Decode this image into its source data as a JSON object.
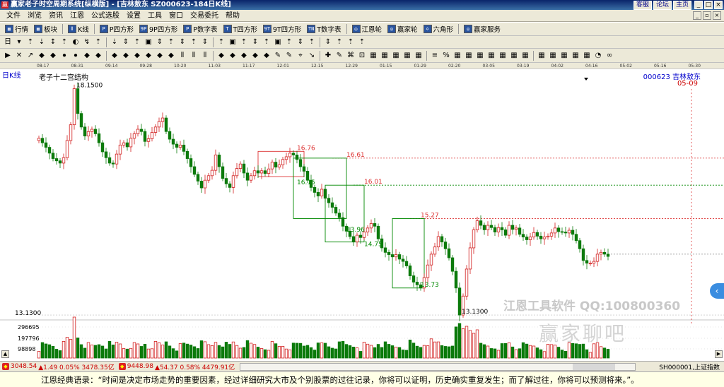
{
  "window": {
    "title": "赢家老子时空周期系统[纵横版] - [吉林敖东  SZ000623-184日K线]",
    "app_icon": "赢",
    "title_links": [
      "客服",
      "论坛",
      "主页"
    ],
    "buttons": [
      "_",
      "□",
      "×"
    ]
  },
  "menu": {
    "items": [
      "文件",
      "浏览",
      "资讯",
      "江恩",
      "公式选股",
      "设置",
      "工具",
      "窗口",
      "交易委托",
      "帮助"
    ],
    "window_controls": [
      "_",
      "▫",
      "×"
    ]
  },
  "toolbar1": {
    "items": [
      {
        "icon": "▦",
        "label": "行情"
      },
      {
        "icon": "▦",
        "label": "板块"
      },
      {
        "icon": "⫴",
        "label": "K线"
      },
      {
        "icon": "P",
        "label": "P四方形"
      },
      {
        "icon": "9P",
        "label": "9P四方形"
      },
      {
        "icon": "P",
        "label": "P数字表"
      },
      {
        "icon": "T",
        "label": "T四方形"
      },
      {
        "icon": "9T",
        "label": "9T四方形"
      },
      {
        "icon": "TN",
        "label": "T数字表"
      },
      {
        "icon": "◎",
        "label": "江恩轮"
      },
      {
        "icon": "◎",
        "label": "赢家轮"
      },
      {
        "icon": "✡",
        "label": "六角形"
      },
      {
        "icon": "◎",
        "label": "赢家服务"
      }
    ]
  },
  "toolbar2_icons": [
    "日",
    "▾",
    "⇡",
    "⇣",
    "↕",
    "⇡",
    "◐",
    "↯",
    "⇡",
    "⇣",
    "⇕",
    "⇡",
    "▣",
    "⇕",
    "⇡",
    "⇕",
    "⇡",
    "⇕",
    "⇡",
    "▣",
    "⇡",
    "⇕",
    "⇡",
    "▣",
    "⇡",
    "⇕",
    "⇡",
    "⇕",
    "⇡",
    "⇡",
    "⇡"
  ],
  "toolbar3_icons": [
    "▶",
    "✕",
    "↗",
    "◆",
    "◆",
    "⦁",
    "⦁",
    "◆",
    "◆",
    "◆",
    "◆",
    "◆",
    "◆",
    "◆",
    "◆",
    "⫴",
    "⫴",
    "⫴",
    "◆",
    "◆",
    "◆",
    "◆",
    "◆",
    "✎",
    "✎",
    "⌖",
    "↘",
    "✚",
    "✎",
    "⌘",
    "⊡",
    "▦",
    "▦",
    "▦",
    "▦",
    "▦",
    "≡",
    "%",
    "▦",
    "▦",
    "▦",
    "▦",
    "▦",
    "▦",
    "▦",
    "▦",
    "▦",
    "▦",
    "▦",
    "▦",
    "◔",
    "∞"
  ],
  "date_ticks": [
    "08-17",
    "08-31",
    "09-14",
    "09-28",
    "10-20",
    "11-03",
    "11-17",
    "12-01",
    "12-15",
    "12-29",
    "01-15",
    "01-29",
    "02-20",
    "03-05",
    "03-19",
    "04-02",
    "04-16",
    "05-02",
    "05-16",
    "05-30"
  ],
  "chart": {
    "period_label": "日K线",
    "structure_label": "老子十二宫结构",
    "stock_label": "000623 吉林敖东",
    "target_date": "05-09",
    "low_axis_label": "13.1300",
    "volume_labels": [
      "296695",
      "197796",
      "98898"
    ]
  },
  "chart_data": {
    "type": "candlestick",
    "stock": "000623 吉林敖东",
    "period": "日K线",
    "high_label": "18.1500",
    "low_label": "13.1300",
    "level_labels": [
      "16.76",
      "16.61",
      "16.01",
      "16.15",
      "15.27",
      "14.75",
      "13.96",
      "13.73"
    ],
    "ylim": [
      13.1,
      18.3
    ],
    "volume_ticks": [
      296695,
      197796,
      98898
    ],
    "closes": [
      17.05,
      16.95,
      16.85,
      16.72,
      16.6,
      16.55,
      16.5,
      16.62,
      17.0,
      17.35,
      18.15,
      17.6,
      17.3,
      17.1,
      17.2,
      17.25,
      17.15,
      16.95,
      16.75,
      16.62,
      16.5,
      16.48,
      16.7,
      16.9,
      16.95,
      16.86,
      17.05,
      17.15,
      17.25,
      17.2,
      16.98,
      17.04,
      17.18,
      17.3,
      17.42,
      17.5,
      17.2,
      17.03,
      16.92,
      16.85,
      16.9,
      16.76,
      16.6,
      16.42,
      16.25,
      16.1,
      15.95,
      16.12,
      16.22,
      16.34,
      16.68,
      16.42,
      16.16,
      16.04,
      15.96,
      16.22,
      16.38,
      16.48,
      16.28,
      16.12,
      16.22,
      16.33,
      16.28,
      16.33,
      16.27,
      16.37,
      16.52,
      16.41,
      16.46,
      16.58,
      16.64,
      16.72,
      16.68,
      16.58,
      16.42,
      16.32,
      16.12,
      15.96,
      15.85,
      15.77,
      15.92,
      15.72,
      15.62,
      15.52,
      15.39,
      15.29,
      15.1,
      14.99,
      14.87,
      14.75,
      14.9,
      14.85,
      14.97,
      15.06,
      15.16,
      15.1,
      14.82,
      14.62,
      14.52,
      14.47,
      14.42,
      14.47,
      14.37,
      14.32,
      14.22,
      14.0,
      13.86,
      13.8,
      13.73,
      13.96,
      14.24,
      14.48,
      14.64,
      14.87,
      14.75,
      14.6,
      14.4,
      14.1,
      13.73,
      13.13,
      13.55,
      14.15,
      14.62,
      15.02,
      15.22,
      15.12,
      15.02,
      15.12,
      15.07,
      14.97,
      15.07,
      15.02,
      14.9,
      15.12,
      15.03,
      15.06,
      14.92,
      14.86,
      14.8,
      14.86,
      14.96,
      14.88,
      14.82,
      14.86,
      14.88,
      14.95,
      15.06,
      14.98,
      14.97,
      14.95,
      15.01,
      14.92,
      14.78,
      14.6,
      14.34,
      14.28,
      14.28,
      14.32,
      14.48,
      14.52,
      14.48,
      14.43
    ]
  },
  "status_bar": {
    "sh_index": "3048.54",
    "sh_change": "▲1.49 0.05% 3478.35亿",
    "sz_index": "9448.98",
    "sz_change": "▲54.37 0.58% 4479.91亿",
    "index_code": "SH000001,上证指数"
  },
  "watermark": {
    "line1": "江恩工具软件  QQ:100800360",
    "line2": "赢家聊吧"
  },
  "quote": "江恩经典语录：“时间是决定市场走势的重要因素，经过详细研究大市及个别股票的过往记录，你将可以证明，历史确实重复发生；而了解过往，你将可以预测将来。”。"
}
